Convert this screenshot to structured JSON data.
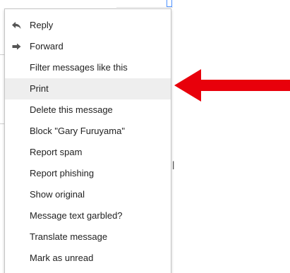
{
  "menu": {
    "items": [
      {
        "label": "Reply",
        "icon": "reply-icon"
      },
      {
        "label": "Forward",
        "icon": "forward-icon"
      },
      {
        "label": "Filter messages like this"
      },
      {
        "label": "Print",
        "highlighted": true
      },
      {
        "label": "Delete this message"
      },
      {
        "label": "Block \"Gary Furuyama\""
      },
      {
        "label": "Report spam"
      },
      {
        "label": "Report phishing"
      },
      {
        "label": "Show original"
      },
      {
        "label": "Message text garbled?"
      },
      {
        "label": "Translate message"
      },
      {
        "label": "Mark as unread"
      }
    ]
  },
  "annotation": {
    "arrow_icon": "red-arrow-left-icon",
    "color": "#e8000b",
    "points_to": "Print"
  },
  "colors": {
    "highlight": "#eeeeee",
    "text": "#222222",
    "icon": "#555555",
    "menu_border": "#c6c6c6"
  }
}
